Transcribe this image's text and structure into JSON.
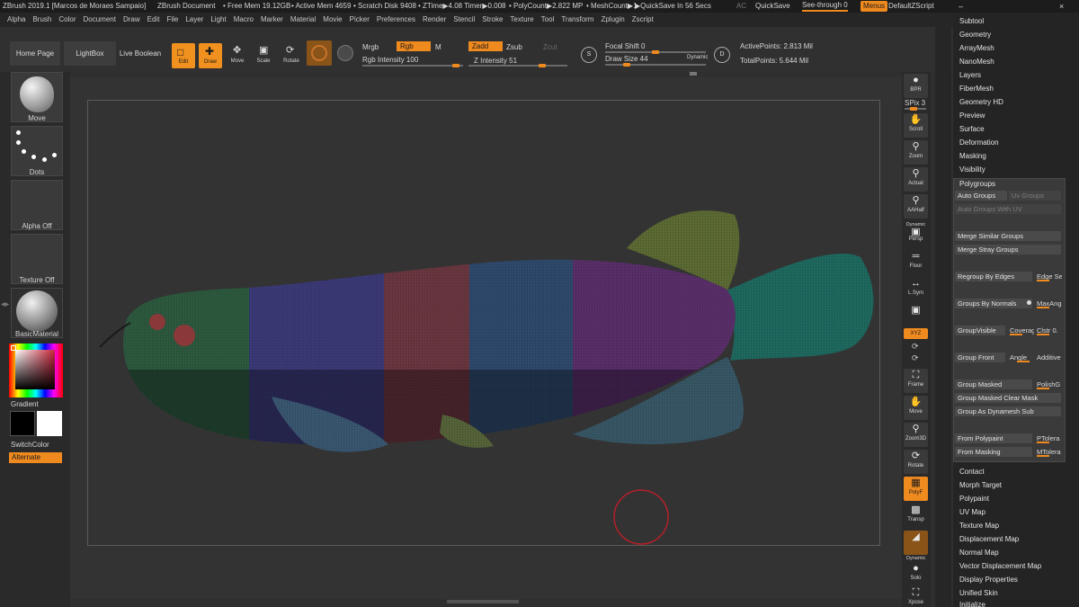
{
  "titlebar": {
    "app_title": "ZBrush 2019.1 [Marcos de Moraes Sampaio]",
    "document": "ZBrush Document",
    "free_mem": "• Free Mem 19.12GB",
    "active_mem": "• Active Mem 4659",
    "scratch": "• Scratch Disk 9408",
    "ztime": "• ZTime▶4.08 Timer▶0.008",
    "polycount": "• PolyCount▶2.822 MP",
    "meshcount": "• MeshCount▶1",
    "quicksave_in": "▶QuickSave In 56 Secs",
    "ac": "AC",
    "quicksave": "QuickSave",
    "seethrough": "See-through  0",
    "menus": "Menus",
    "defaultzscript": "DefaultZScript"
  },
  "menubar": [
    "Alpha",
    "Brush",
    "Color",
    "Document",
    "Draw",
    "Edit",
    "File",
    "Layer",
    "Light",
    "Macro",
    "Marker",
    "Material",
    "Movie",
    "Picker",
    "Preferences",
    "Render",
    "Stencil",
    "Stroke",
    "Texture",
    "Tool",
    "Transform",
    "Zplugin",
    "Zscript"
  ],
  "toolbar": {
    "home_page": "Home Page",
    "lightbox": "LightBox",
    "live_boolean": "Live Boolean",
    "edit": "Edit",
    "draw": "Draw",
    "move": "Move",
    "scale": "Scale",
    "rotate": "Rotate",
    "mrgb": "Mrgb",
    "rgb": "Rgb",
    "m": "M",
    "zadd": "Zadd",
    "zsub": "Zsub",
    "zcut": "Zcut",
    "rgb_intensity": "Rgb Intensity 100",
    "z_intensity": "Z Intensity 51",
    "focal_shift": "Focal Shift 0",
    "draw_size": "Draw Size 44",
    "dynamic": "Dynamic",
    "active_points": "ActivePoints: 2.813 Mil",
    "total_points": "TotalPoints: 5.644 Mil",
    "s": "S",
    "d": "D"
  },
  "leftshelf": {
    "brush": "Move",
    "stroke": "Dots",
    "alpha": "Alpha Off",
    "texture": "Texture Off",
    "material": "BasicMaterial",
    "gradient": "Gradient",
    "switchcolor": "SwitchColor",
    "alternate": "Alternate"
  },
  "rightshelf": {
    "bpr": "BPR",
    "spix": "SPix 3",
    "scroll": "Scroll",
    "zoom": "Zoom",
    "actual": "Actual",
    "aahalf": "AAHalf",
    "dynamic": "Dynamic",
    "persp": "Persp",
    "floor": "Floor",
    "lsym": "L.Sym",
    "xyz": "XYZ",
    "frame": "Frame",
    "move": "Move",
    "zoom3d": "Zoom3D",
    "rotate": "Rotate",
    "polyf": "PolyF",
    "transp": "Transp",
    "dynamic2": "Dynamic",
    "solo": "Solo",
    "xpose": "Xpose"
  },
  "rpanel": {
    "top_items": [
      "Subtool",
      "Geometry",
      "ArrayMesh",
      "NanoMesh",
      "Layers",
      "FiberMesh",
      "Geometry HD",
      "Preview",
      "Surface",
      "Deformation",
      "Masking",
      "Visibility"
    ],
    "polygroups": {
      "title": "Polygroups",
      "auto_groups": "Auto Groups",
      "uv_groups": "Uv Groups",
      "auto_groups_uv": "Auto Groups With UV",
      "merge_similar": "Merge Similar Groups",
      "merge_stray": "Merge Stray Groups",
      "regroup_edges": "Regroup By Edges",
      "edge_se": "Edge Se",
      "groups_normals": "Groups By Normals",
      "maxang": "MaxAng",
      "groupvisible": "GroupVisible",
      "coverage": "Coverag",
      "clstr": "Clstr 0.",
      "group_front": "Group Front",
      "angle": "Angle",
      "additive": "Additive",
      "group_masked": "Group Masked",
      "polishg": "PolishG",
      "group_masked_clear": "Group Masked Clear Mask",
      "group_dynamesh": "Group As Dynamesh Sub",
      "from_polypaint": "From Polypaint",
      "ptolera": "PTolera",
      "from_masking": "From Masking",
      "mtolera": "MTolera"
    },
    "bottom_items": [
      "Contact",
      "Morph Target",
      "Polypaint",
      "UV Map",
      "Texture Map",
      "Displacement Map",
      "Normal Map",
      "Vector Displacement Map",
      "Display Properties",
      "Unified Skin",
      "Initialize"
    ]
  },
  "colors": {
    "accent": "#ef8a1f"
  }
}
